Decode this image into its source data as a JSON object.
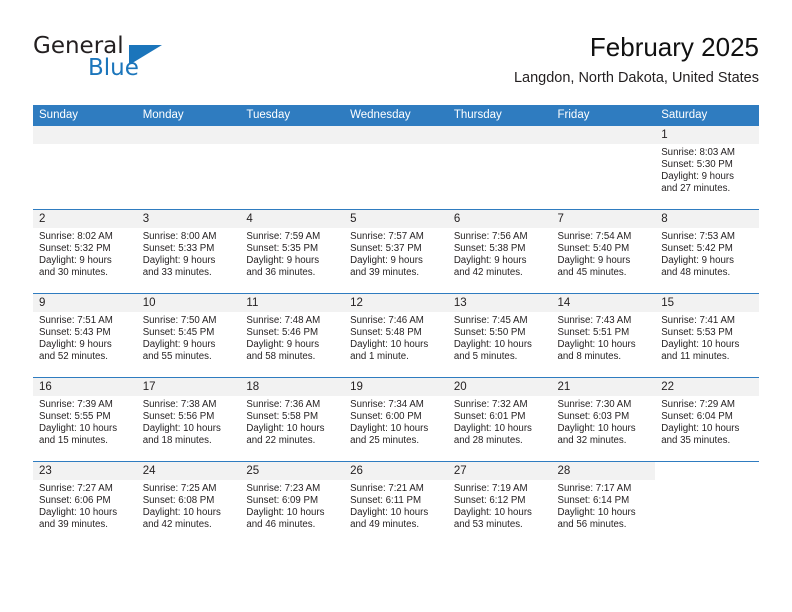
{
  "brand": {
    "name_part1": "General",
    "name_part2": "Blue",
    "logo_icon": "triangle-logo-icon"
  },
  "header": {
    "title": "February 2025",
    "subtitle": "Langdon, North Dakota, United States"
  },
  "colors": {
    "header_blue": "#2f7cc0",
    "brand_blue": "#1b75bb",
    "daynum_band": "#f2f2f2",
    "text": "#231f20"
  },
  "weekdays": [
    "Sunday",
    "Monday",
    "Tuesday",
    "Wednesday",
    "Thursday",
    "Friday",
    "Saturday"
  ],
  "weeks": [
    [
      {
        "day": "",
        "empty": true
      },
      {
        "day": "",
        "empty": true
      },
      {
        "day": "",
        "empty": true
      },
      {
        "day": "",
        "empty": true
      },
      {
        "day": "",
        "empty": true
      },
      {
        "day": "",
        "empty": true
      },
      {
        "day": "1",
        "sunrise": "Sunrise: 8:03 AM",
        "sunset": "Sunset: 5:30 PM",
        "daylight1": "Daylight: 9 hours",
        "daylight2": "and 27 minutes."
      }
    ],
    [
      {
        "day": "2",
        "sunrise": "Sunrise: 8:02 AM",
        "sunset": "Sunset: 5:32 PM",
        "daylight1": "Daylight: 9 hours",
        "daylight2": "and 30 minutes."
      },
      {
        "day": "3",
        "sunrise": "Sunrise: 8:00 AM",
        "sunset": "Sunset: 5:33 PM",
        "daylight1": "Daylight: 9 hours",
        "daylight2": "and 33 minutes."
      },
      {
        "day": "4",
        "sunrise": "Sunrise: 7:59 AM",
        "sunset": "Sunset: 5:35 PM",
        "daylight1": "Daylight: 9 hours",
        "daylight2": "and 36 minutes."
      },
      {
        "day": "5",
        "sunrise": "Sunrise: 7:57 AM",
        "sunset": "Sunset: 5:37 PM",
        "daylight1": "Daylight: 9 hours",
        "daylight2": "and 39 minutes."
      },
      {
        "day": "6",
        "sunrise": "Sunrise: 7:56 AM",
        "sunset": "Sunset: 5:38 PM",
        "daylight1": "Daylight: 9 hours",
        "daylight2": "and 42 minutes."
      },
      {
        "day": "7",
        "sunrise": "Sunrise: 7:54 AM",
        "sunset": "Sunset: 5:40 PM",
        "daylight1": "Daylight: 9 hours",
        "daylight2": "and 45 minutes."
      },
      {
        "day": "8",
        "sunrise": "Sunrise: 7:53 AM",
        "sunset": "Sunset: 5:42 PM",
        "daylight1": "Daylight: 9 hours",
        "daylight2": "and 48 minutes."
      }
    ],
    [
      {
        "day": "9",
        "sunrise": "Sunrise: 7:51 AM",
        "sunset": "Sunset: 5:43 PM",
        "daylight1": "Daylight: 9 hours",
        "daylight2": "and 52 minutes."
      },
      {
        "day": "10",
        "sunrise": "Sunrise: 7:50 AM",
        "sunset": "Sunset: 5:45 PM",
        "daylight1": "Daylight: 9 hours",
        "daylight2": "and 55 minutes."
      },
      {
        "day": "11",
        "sunrise": "Sunrise: 7:48 AM",
        "sunset": "Sunset: 5:46 PM",
        "daylight1": "Daylight: 9 hours",
        "daylight2": "and 58 minutes."
      },
      {
        "day": "12",
        "sunrise": "Sunrise: 7:46 AM",
        "sunset": "Sunset: 5:48 PM",
        "daylight1": "Daylight: 10 hours",
        "daylight2": "and 1 minute."
      },
      {
        "day": "13",
        "sunrise": "Sunrise: 7:45 AM",
        "sunset": "Sunset: 5:50 PM",
        "daylight1": "Daylight: 10 hours",
        "daylight2": "and 5 minutes."
      },
      {
        "day": "14",
        "sunrise": "Sunrise: 7:43 AM",
        "sunset": "Sunset: 5:51 PM",
        "daylight1": "Daylight: 10 hours",
        "daylight2": "and 8 minutes."
      },
      {
        "day": "15",
        "sunrise": "Sunrise: 7:41 AM",
        "sunset": "Sunset: 5:53 PM",
        "daylight1": "Daylight: 10 hours",
        "daylight2": "and 11 minutes."
      }
    ],
    [
      {
        "day": "16",
        "sunrise": "Sunrise: 7:39 AM",
        "sunset": "Sunset: 5:55 PM",
        "daylight1": "Daylight: 10 hours",
        "daylight2": "and 15 minutes."
      },
      {
        "day": "17",
        "sunrise": "Sunrise: 7:38 AM",
        "sunset": "Sunset: 5:56 PM",
        "daylight1": "Daylight: 10 hours",
        "daylight2": "and 18 minutes."
      },
      {
        "day": "18",
        "sunrise": "Sunrise: 7:36 AM",
        "sunset": "Sunset: 5:58 PM",
        "daylight1": "Daylight: 10 hours",
        "daylight2": "and 22 minutes."
      },
      {
        "day": "19",
        "sunrise": "Sunrise: 7:34 AM",
        "sunset": "Sunset: 6:00 PM",
        "daylight1": "Daylight: 10 hours",
        "daylight2": "and 25 minutes."
      },
      {
        "day": "20",
        "sunrise": "Sunrise: 7:32 AM",
        "sunset": "Sunset: 6:01 PM",
        "daylight1": "Daylight: 10 hours",
        "daylight2": "and 28 minutes."
      },
      {
        "day": "21",
        "sunrise": "Sunrise: 7:30 AM",
        "sunset": "Sunset: 6:03 PM",
        "daylight1": "Daylight: 10 hours",
        "daylight2": "and 32 minutes."
      },
      {
        "day": "22",
        "sunrise": "Sunrise: 7:29 AM",
        "sunset": "Sunset: 6:04 PM",
        "daylight1": "Daylight: 10 hours",
        "daylight2": "and 35 minutes."
      }
    ],
    [
      {
        "day": "23",
        "sunrise": "Sunrise: 7:27 AM",
        "sunset": "Sunset: 6:06 PM",
        "daylight1": "Daylight: 10 hours",
        "daylight2": "and 39 minutes."
      },
      {
        "day": "24",
        "sunrise": "Sunrise: 7:25 AM",
        "sunset": "Sunset: 6:08 PM",
        "daylight1": "Daylight: 10 hours",
        "daylight2": "and 42 minutes."
      },
      {
        "day": "25",
        "sunrise": "Sunrise: 7:23 AM",
        "sunset": "Sunset: 6:09 PM",
        "daylight1": "Daylight: 10 hours",
        "daylight2": "and 46 minutes."
      },
      {
        "day": "26",
        "sunrise": "Sunrise: 7:21 AM",
        "sunset": "Sunset: 6:11 PM",
        "daylight1": "Daylight: 10 hours",
        "daylight2": "and 49 minutes."
      },
      {
        "day": "27",
        "sunrise": "Sunrise: 7:19 AM",
        "sunset": "Sunset: 6:12 PM",
        "daylight1": "Daylight: 10 hours",
        "daylight2": "and 53 minutes."
      },
      {
        "day": "28",
        "sunrise": "Sunrise: 7:17 AM",
        "sunset": "Sunset: 6:14 PM",
        "daylight1": "Daylight: 10 hours",
        "daylight2": "and 56 minutes."
      },
      {
        "day": "",
        "empty": true,
        "nofill": true
      }
    ]
  ]
}
